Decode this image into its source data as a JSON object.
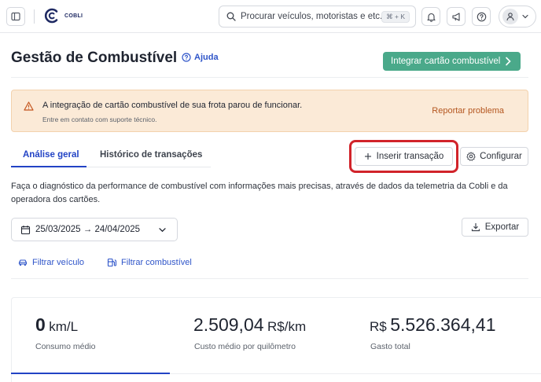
{
  "topbar": {
    "brand": "COBLI",
    "search_placeholder": "Procurar veículos, motoristas e etc...",
    "shortcut": "⌘ + K",
    "icons": [
      "sidebar-toggle-icon",
      "bell-icon",
      "megaphone-icon",
      "question-icon",
      "user-icon",
      "chevron-down-icon"
    ]
  },
  "header": {
    "title": "Gestão de Combustível",
    "help_label": "Ajuda",
    "integrate_label": "Integrar cartão combustível"
  },
  "alert": {
    "title": "A integração de cartão combustível de sua frota parou de funcionar.",
    "subtitle": "Entre em contato com suporte técnico.",
    "action": "Reportar problema"
  },
  "tabs": [
    {
      "label": "Análise geral",
      "active": true
    },
    {
      "label": "Histórico de transações",
      "active": false
    }
  ],
  "actions": {
    "insert_label": "Inserir transação",
    "config_label": "Configurar",
    "export_label": "Exportar"
  },
  "description": "Faça o diagnóstico da performance de combustível com informações mais precisas, através de dados da telemetria da Cobli e da operadora dos cartões.",
  "date_range": "25/03/2025 → 24/04/2025",
  "filters": {
    "vehicle_label": "Filtrar veículo",
    "fuel_label": "Filtrar combustível"
  },
  "stats": [
    {
      "number": "0",
      "unit": "km/L",
      "label": "Consumo médio"
    },
    {
      "number": "2.509,04",
      "unit": "R$/km",
      "label": "Custo médio por quilômetro"
    },
    {
      "prefix": "R$",
      "number": "5.526.364,41",
      "label": "Gasto total"
    }
  ],
  "colors": {
    "accent_blue": "#2243c5",
    "integrate_green": "#4aa98a",
    "alert_bg": "#fbead7",
    "alert_link": "#b4561f",
    "highlight_red": "#d1232a"
  }
}
